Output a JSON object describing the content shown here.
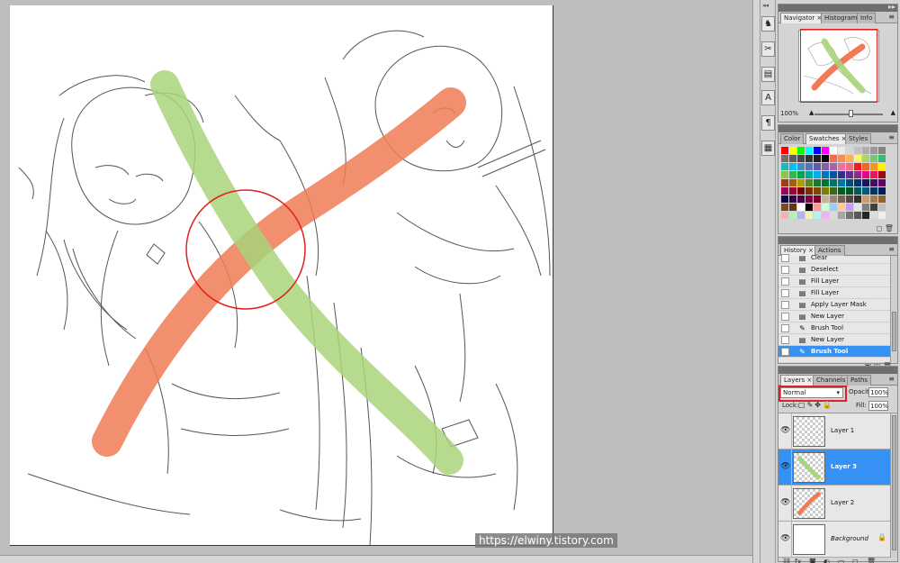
{
  "watermark": "https://elwiny.tistory.com",
  "colors": {
    "green_stroke": "#a9d47a",
    "orange_stroke": "#f07b55",
    "highlight_red": "#e02020",
    "selection_blue": "#3591f4"
  },
  "tools": [
    {
      "icon": "puppet-icon",
      "glyph": "♞"
    },
    {
      "icon": "tools-icon",
      "glyph": "✂"
    },
    {
      "icon": "layer-comps-icon",
      "glyph": "▤"
    },
    {
      "icon": "character-icon",
      "glyph": "A"
    },
    {
      "icon": "paragraph-icon",
      "glyph": "¶"
    },
    {
      "icon": "brush-presets-icon",
      "glyph": "▦"
    }
  ],
  "navigator": {
    "tabs": [
      "Navigator",
      "Histogram",
      "Info"
    ],
    "zoom": "100%"
  },
  "swatches": {
    "tabs": [
      "Color",
      "Swatches",
      "Styles"
    ],
    "rows": [
      [
        "#ff0000",
        "#ffff00",
        "#00ff00",
        "#00ffff",
        "#0000ff",
        "#ff00ff",
        "#ffffff",
        "#ebebeb",
        "#d6d6d6",
        "#c2c2c2",
        "#adadad",
        "#999999",
        "#858585"
      ],
      [
        "#707070",
        "#5c5c5c",
        "#474747",
        "#333333",
        "#1f1f1f",
        "#000000",
        "#f26c4f",
        "#f68e56",
        "#fbaf5d",
        "#fff568",
        "#acd372",
        "#7cc576",
        "#3bb878"
      ],
      [
        "#1abbb4",
        "#00bff3",
        "#438ccb",
        "#5574b9",
        "#605ca8",
        "#855fa8",
        "#a763a8",
        "#f06ea9",
        "#f26d7d",
        "#ed1c24",
        "#f26522",
        "#f7941d",
        "#fff200"
      ],
      [
        "#8dc63f",
        "#39b54a",
        "#00a651",
        "#00a99d",
        "#00aeef",
        "#0072bc",
        "#0054a6",
        "#2e3192",
        "#662d91",
        "#92278f",
        "#ec008c",
        "#ed145b",
        "#9e0b0f"
      ],
      [
        "#a0410d",
        "#a36209",
        "#aba000",
        "#598527",
        "#1a7b30",
        "#007236",
        "#00746b",
        "#0076a3",
        "#004b80",
        "#003471",
        "#1b1464",
        "#440e62",
        "#630460"
      ],
      [
        "#9e005d",
        "#9e0039",
        "#790000",
        "#7b2e00",
        "#7d4900",
        "#827b00",
        "#406618",
        "#005e20",
        "#005826",
        "#005952",
        "#005b7f",
        "#003663",
        "#002157"
      ],
      [
        "#0d004c",
        "#32004b",
        "#4b0049",
        "#7b0046",
        "#7a0026",
        "#c7b299",
        "#998675",
        "#736357",
        "#534741",
        "#37302a",
        "#c69c6d",
        "#a67c52",
        "#8c6239"
      ],
      [
        "#754c24",
        "#603913",
        "#ffffff",
        "#000000",
        "#ff9999",
        "#ccffcc",
        "#99ccff",
        "#ffcc99",
        "#cc99ff",
        "#e6e6e6",
        "#808080",
        "#404040",
        "#bfbfbf"
      ],
      [
        "#f2b3b3",
        "#b3f2b3",
        "#b3b3f2",
        "#f2f2b3",
        "#b3f2f2",
        "#f2b3f2",
        "#d9d9d9",
        "#a6a6a6",
        "#737373",
        "#595959",
        "#262626",
        "#dddddd",
        "#eeeeee"
      ]
    ]
  },
  "history": {
    "tabs": [
      "History",
      "Actions"
    ],
    "items": [
      {
        "label": "Clear",
        "icon": "history-step-icon"
      },
      {
        "label": "Deselect",
        "icon": "history-step-icon"
      },
      {
        "label": "Fill Layer",
        "icon": "history-step-icon"
      },
      {
        "label": "Fill Layer",
        "icon": "history-step-icon"
      },
      {
        "label": "Apply Layer Mask",
        "icon": "history-step-icon"
      },
      {
        "label": "New Layer",
        "icon": "history-step-icon"
      },
      {
        "label": "Brush Tool",
        "icon": "brush-icon"
      },
      {
        "label": "New Layer",
        "icon": "history-step-icon"
      },
      {
        "label": "Brush Tool",
        "icon": "brush-icon"
      }
    ],
    "selected_index": 8
  },
  "layers": {
    "tabs": [
      "Layers",
      "Channels",
      "Paths"
    ],
    "blend_mode": "Normal",
    "opacity_label": "Opacity:",
    "opacity": "100%",
    "lock_label": "Lock:",
    "fill_label": "Fill:",
    "fill": "100%",
    "items": [
      {
        "name": "Layer 1",
        "visible": true,
        "thumb": "transparent"
      },
      {
        "name": "Layer 3",
        "visible": true,
        "thumb": "green"
      },
      {
        "name": "Layer 2",
        "visible": true,
        "thumb": "orange"
      },
      {
        "name": "Background",
        "visible": true,
        "thumb": "white",
        "locked": true
      }
    ],
    "selected_index": 1
  }
}
